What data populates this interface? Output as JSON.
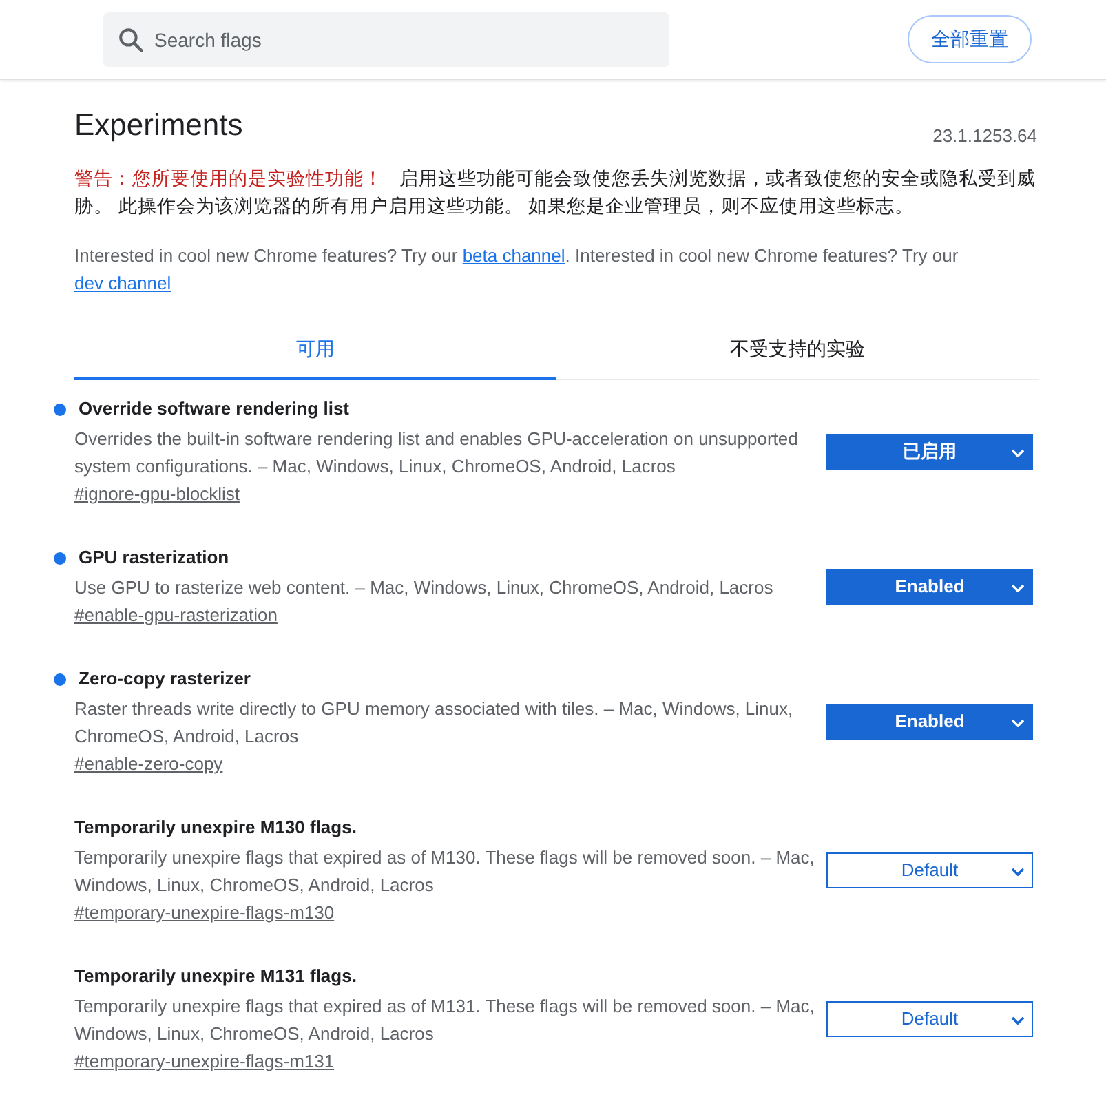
{
  "header": {
    "search": {
      "placeholder": "Search flags"
    },
    "reset_button": "全部重置"
  },
  "page": {
    "title": "Experiments",
    "version": "23.1.1253.64",
    "warning": {
      "title": "警告：您所要使用的是实验性功能！",
      "text": "启用这些功能可能会致使您丢失浏览数据，或者致使您的安全或隐私受到威胁。 此操作会为该浏览器的所有用户启用这些功能。 如果您是企业管理员，则不应使用这些标志。"
    },
    "intro": [
      {
        "kind": "text",
        "text": "Interested in cool new Chrome features? Try our "
      },
      {
        "kind": "link",
        "text": "beta channel"
      },
      {
        "kind": "text",
        "text": ". Interested in cool new Chrome features? Try our "
      },
      {
        "kind": "link",
        "text": "dev channel"
      }
    ]
  },
  "tabs": [
    {
      "label": "可用",
      "selected": true
    },
    {
      "label": "不受支持的实验",
      "selected": false
    }
  ],
  "flags": [
    {
      "name": "Override software rendering list",
      "modified": true,
      "description": "Overrides the built-in software rendering list and enables GPU-acceleration on unsupported system configurations. – Mac, Windows, Linux, ChromeOS, Android, Lacros",
      "link": "#ignore-gpu-blocklist",
      "value": "已启用"
    },
    {
      "name": "GPU rasterization",
      "modified": true,
      "description": "Use GPU to rasterize web content. – Mac, Windows, Linux, ChromeOS, Android, Lacros",
      "link": "#enable-gpu-rasterization",
      "value": "Enabled"
    },
    {
      "name": "Zero-copy rasterizer",
      "modified": true,
      "description": "Raster threads write directly to GPU memory associated with tiles. – Mac, Windows, Linux, ChromeOS, Android, Lacros",
      "link": "#enable-zero-copy",
      "value": "Enabled"
    },
    {
      "name": "Temporarily unexpire M130 flags.",
      "modified": false,
      "description": "Temporarily unexpire flags that expired as of M130. These flags will be removed soon. – Mac, Windows, Linux, ChromeOS, Android, Lacros",
      "link": "#temporary-unexpire-flags-m130",
      "value": "Default"
    },
    {
      "name": "Temporarily unexpire M131 flags.",
      "modified": false,
      "description": "Temporarily unexpire flags that expired as of M131. These flags will be removed soon. – Mac, Windows, Linux, ChromeOS, Android, Lacros",
      "link": "#temporary-unexpire-flags-m131",
      "value": "Default"
    }
  ]
}
